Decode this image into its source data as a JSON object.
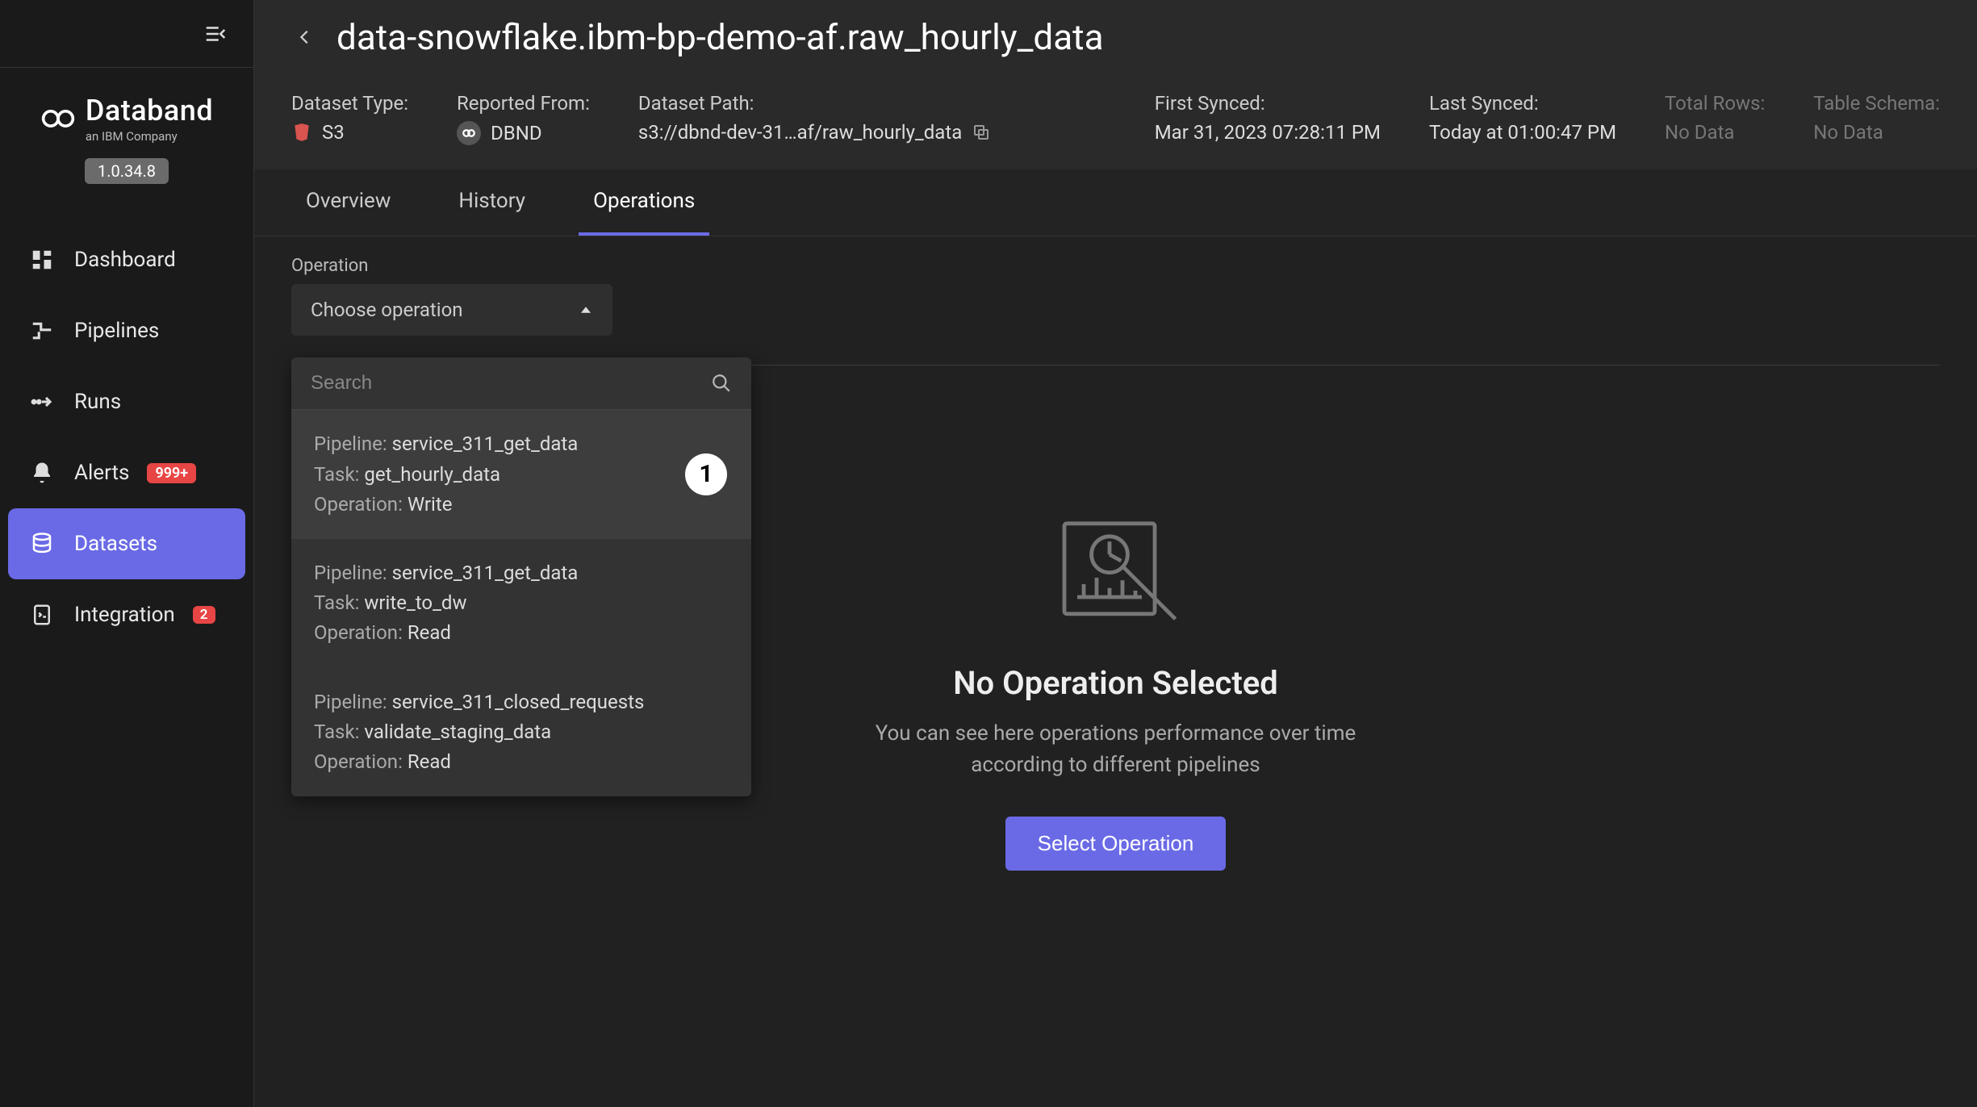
{
  "brand": {
    "name": "Databand",
    "subtitle": "an IBM Company",
    "version": "1.0.34.8"
  },
  "nav": {
    "dashboard": "Dashboard",
    "pipelines": "Pipelines",
    "runs": "Runs",
    "alerts": "Alerts",
    "alerts_badge": "999+",
    "datasets": "Datasets",
    "integration": "Integration",
    "integration_badge": "2"
  },
  "header": {
    "title": "data-snowflake.ibm-bp-demo-af.raw_hourly_data",
    "meta": {
      "dataset_type_label": "Dataset Type:",
      "dataset_type_value": "S3",
      "reported_from_label": "Reported From:",
      "reported_from_value": "DBND",
      "dataset_path_label": "Dataset Path:",
      "dataset_path_value": "s3://dbnd-dev-31…af/raw_hourly_data",
      "first_synced_label": "First Synced:",
      "first_synced_value": "Mar 31, 2023 07:28:11 PM",
      "last_synced_label": "Last Synced:",
      "last_synced_value": "Today at 01:00:47 PM",
      "total_rows_label": "Total Rows:",
      "total_rows_value": "No Data",
      "table_schema_label": "Table Schema:",
      "table_schema_value": "No Data"
    }
  },
  "tabs": {
    "overview": "Overview",
    "history": "History",
    "operations": "Operations"
  },
  "operation": {
    "label": "Operation",
    "placeholder": "Choose operation",
    "search_placeholder": "Search",
    "options": [
      {
        "pipeline": "service_311_get_data",
        "task": "get_hourly_data",
        "operation": "Write"
      },
      {
        "pipeline": "service_311_get_data",
        "task": "write_to_dw",
        "operation": "Read"
      },
      {
        "pipeline": "service_311_closed_requests",
        "task": "validate_staging_data",
        "operation": "Read"
      }
    ],
    "labels": {
      "pipeline": "Pipeline:",
      "task": "Task:",
      "operation": "Operation:"
    },
    "callout": "1"
  },
  "empty": {
    "title": "No Operation Selected",
    "desc": "You can see here operations performance over time according to different pipelines",
    "button": "Select Operation"
  }
}
